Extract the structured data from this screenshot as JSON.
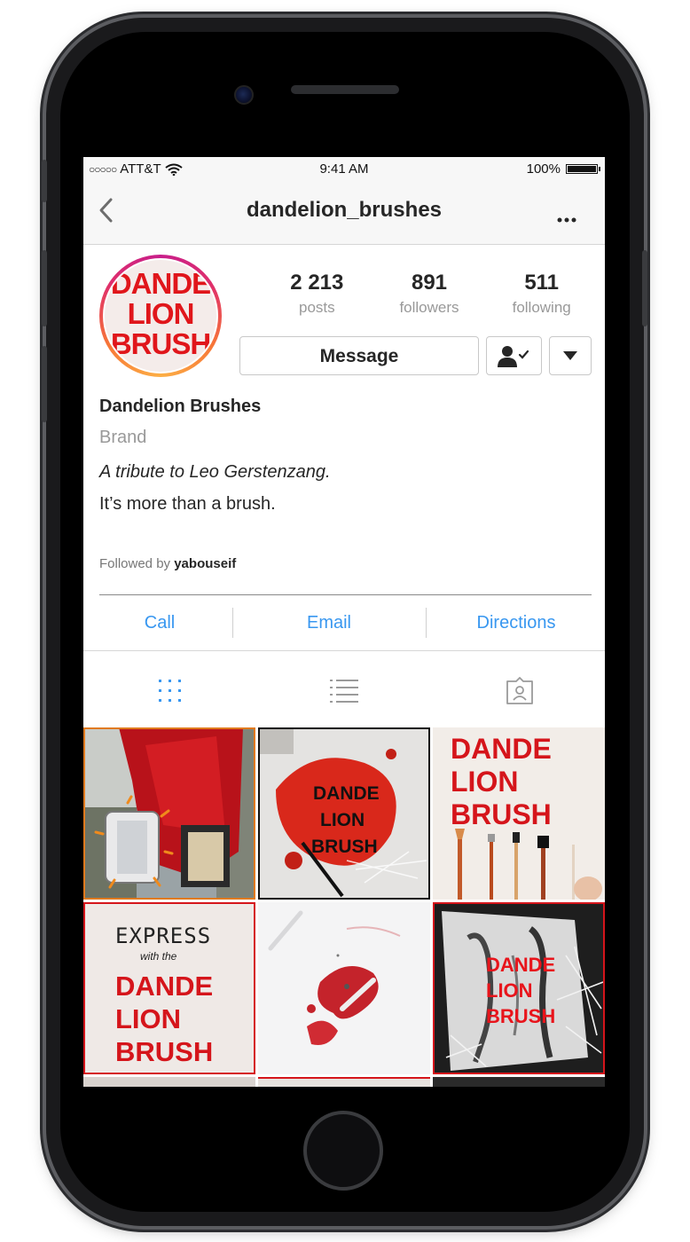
{
  "status_bar": {
    "carrier": "ATT&T",
    "signal_dots": "○○○○○",
    "time": "9:41 AM",
    "battery": "100%"
  },
  "nav": {
    "title": "dandelion_brushes",
    "more": "..."
  },
  "profile": {
    "avatar_lines": [
      "DANDE",
      "LION",
      "BRUSH"
    ],
    "stats": [
      {
        "value": "2 213",
        "label": "posts"
      },
      {
        "value": "891",
        "label": "followers"
      },
      {
        "value": "511",
        "label": "following"
      }
    ],
    "message_label": "Message",
    "name": "Dandelion Brushes",
    "category": "Brand",
    "bio_line1": "A tribute to Leo Gerstenzang.",
    "bio_line2": "It’s more than a brush.",
    "followed_by_prefix": "Followed by",
    "followed_by_user": "yabouseif"
  },
  "contacts": [
    {
      "label": "Call"
    },
    {
      "label": "Email"
    },
    {
      "label": "Directions"
    }
  ],
  "tabs": [
    "grid-view-icon",
    "list-view-icon",
    "tagged-icon"
  ],
  "posts": {
    "tile3": [
      "DANDE",
      "LION",
      "BRUSH"
    ],
    "tile2": [
      "DANDE",
      "LION",
      "BRUSH"
    ],
    "tile4_top": "EXPRESS",
    "tile4_sub": "with the",
    "tile4": [
      "DANDE",
      "LION",
      "BRUSH"
    ],
    "tile6": [
      "DANDE",
      "LION",
      "BRUSH"
    ]
  },
  "colors": {
    "accent_link": "#3897f0",
    "brand_red": "#d5151b",
    "active_tab": "#3897f0"
  }
}
